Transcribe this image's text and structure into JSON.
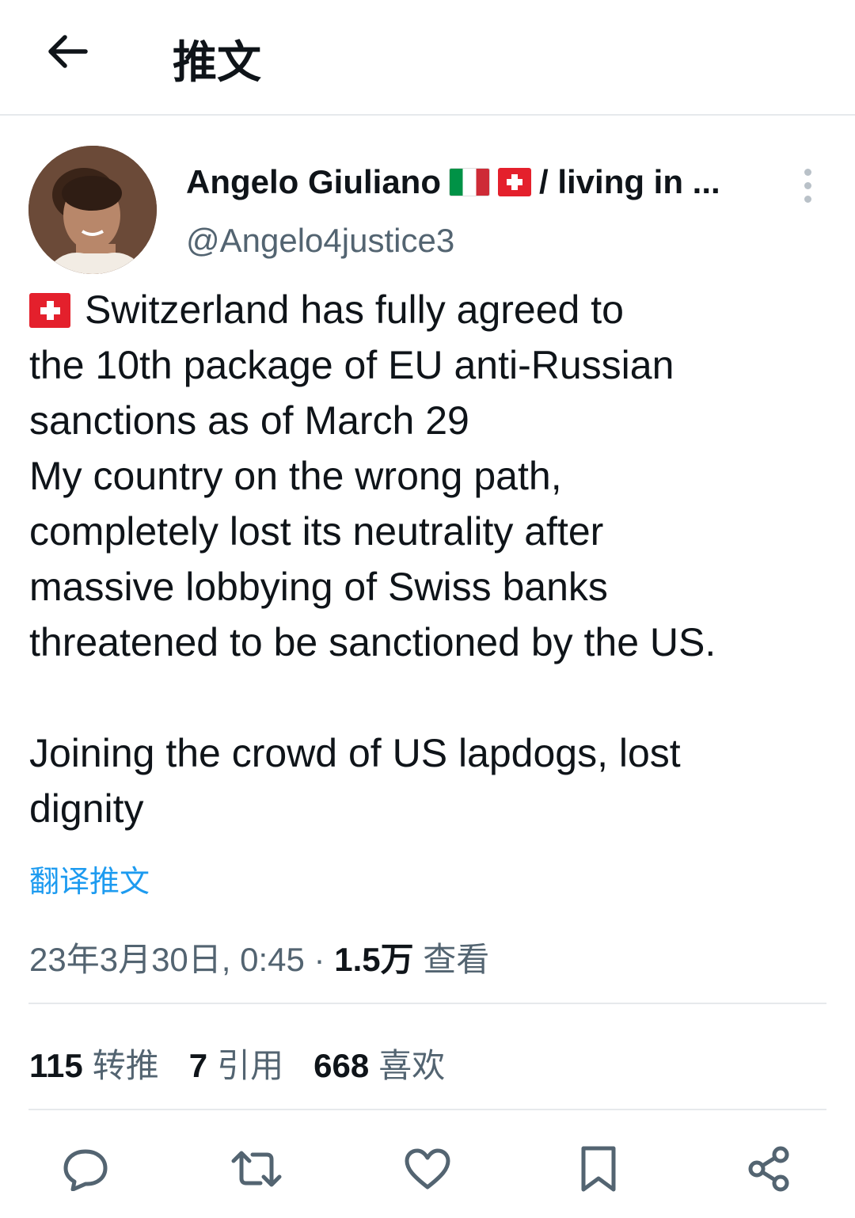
{
  "header": {
    "title": "推文"
  },
  "tweet": {
    "author_name": "Angelo Giuliano",
    "author_name_suffix": "/ living in ...",
    "author_handle": "@Angelo4justice3",
    "lines": [
      "Switzerland has fully agreed to",
      "the 10th package of EU anti-Russian",
      "sanctions as of March 29",
      "My country on the wrong path,",
      "completely lost its neutrality after",
      "massive lobbying of Swiss banks",
      "threatened to be sanctioned by the US.",
      "Joining the crowd of US lapdogs, lost",
      "dignity"
    ],
    "translate_label": "翻译推文",
    "timestamp": "23年3月30日, 0:45",
    "separator": "·",
    "views_count": "1.5万",
    "views_label": "查看"
  },
  "stats": {
    "retweets_count": "115",
    "retweets_label": "转推",
    "quotes_count": "7",
    "quotes_label": "引用",
    "likes_count": "668",
    "likes_label": "喜欢"
  },
  "icons": {
    "back": "arrow-left-icon",
    "more": "more-vertical-icon",
    "reply": "reply-icon",
    "retweet": "retweet-icon",
    "like": "heart-icon",
    "bookmark": "bookmark-icon",
    "share": "share-icon"
  },
  "colors": {
    "link": "#1d9bf0",
    "secondary_text": "#536471",
    "primary_text": "#0f1419"
  }
}
